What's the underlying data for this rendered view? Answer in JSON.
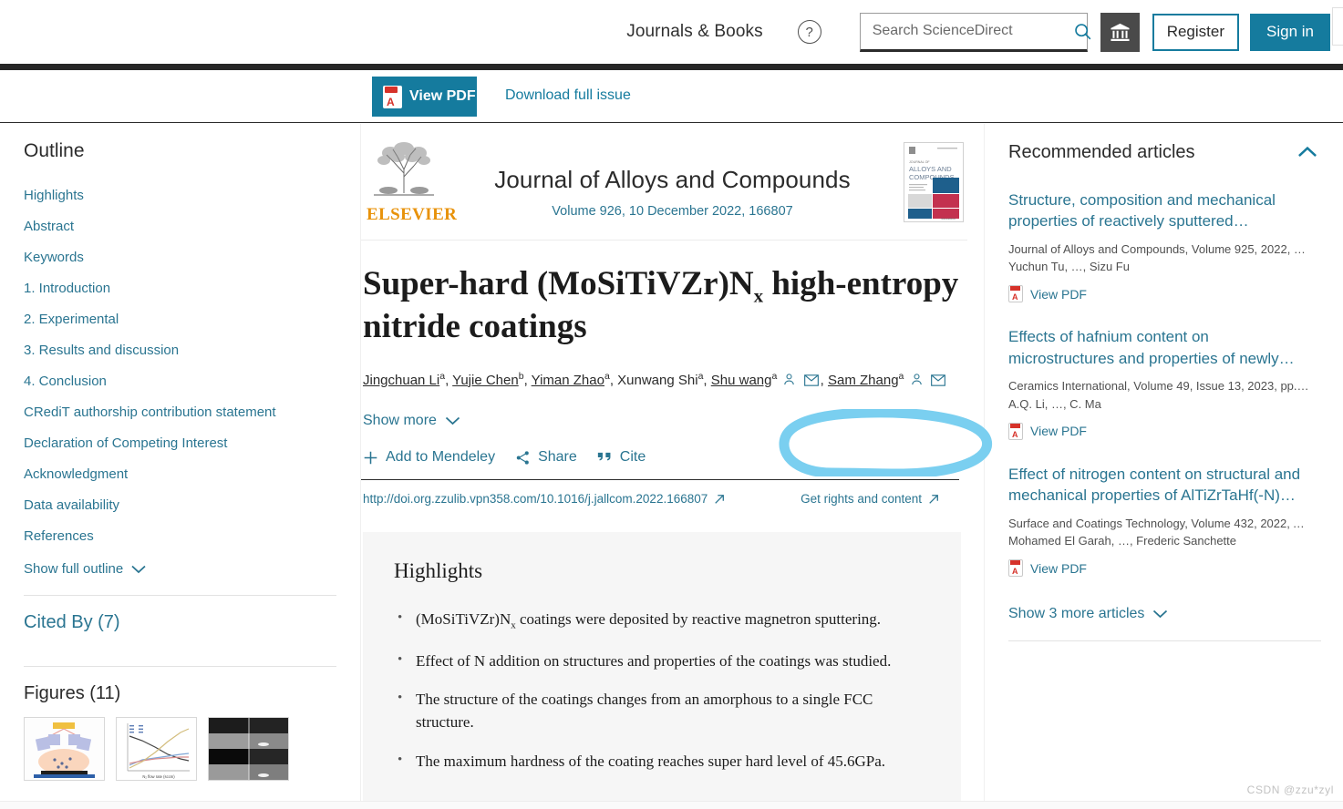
{
  "header": {
    "journals_books": "Journals & Books",
    "help_icon": "question-mark-icon",
    "search_placeholder": "Search ScienceDirect",
    "search_value": "",
    "search_icon": "search-icon",
    "institution_icon": "institution-bank-icon",
    "register_label": "Register",
    "signin_label": "Sign in"
  },
  "pdfbar": {
    "view_pdf_label": "View PDF",
    "download_issue_label": "Download full issue"
  },
  "outline": {
    "title": "Outline",
    "items": [
      {
        "label": "Highlights"
      },
      {
        "label": "Abstract"
      },
      {
        "label": "Keywords"
      },
      {
        "label": "1. Introduction"
      },
      {
        "label": "2. Experimental"
      },
      {
        "label": "3. Results and discussion"
      },
      {
        "label": "4. Conclusion"
      },
      {
        "label": "CRediT authorship contribution statement"
      },
      {
        "label": "Declaration of Competing Interest"
      },
      {
        "label": "Acknowledgment"
      },
      {
        "label": "Data availability"
      },
      {
        "label": "References"
      }
    ],
    "show_full_label": "Show full outline",
    "cited_by_label": "Cited By (7)",
    "figures_label": "Figures (11)"
  },
  "journal": {
    "publisher": "ELSEVIER",
    "name": "Journal of Alloys and Compounds",
    "volume_line": "Volume 926, 10 December 2022, 166807",
    "cover_title_line1": "JOURNAL OF",
    "cover_title_line2": "ALLOYS AND",
    "cover_title_line3": "COMPOUNDS"
  },
  "article": {
    "title_pre": "Super-hard (MoSiTiVZr)N",
    "title_sub": "x",
    "title_post": " high-entropy nitride coatings",
    "authors_html": "Jingchuan Li, Yujie Chen, Yiman Zhao, Xunwang Shi, Shu wang, Sam Zhang",
    "authors": [
      {
        "name": "Jingchuan Li",
        "sup": "a",
        "link": true,
        "icons": []
      },
      {
        "name": "Yujie Chen",
        "sup": "b",
        "link": true,
        "icons": []
      },
      {
        "name": "Yiman Zhao",
        "sup": "a",
        "link": true,
        "icons": []
      },
      {
        "name": "Xunwang Shi",
        "sup": "a",
        "link": false,
        "icons": []
      },
      {
        "name": "Shu wang",
        "sup": "a",
        "link": true,
        "icons": [
          "person-icon",
          "envelope-icon"
        ]
      },
      {
        "name": "Sam Zhang",
        "sup": "a",
        "link": true,
        "icons": [
          "person-icon",
          "envelope-icon"
        ]
      }
    ],
    "show_more_label": "Show more",
    "actions": [
      {
        "label": "Add to Mendeley",
        "icon": "plus-icon"
      },
      {
        "label": "Share",
        "icon": "share-nodes-icon"
      },
      {
        "label": "Cite",
        "icon": "quote-icon"
      }
    ],
    "doi_url": "http://doi.org.zzulib.vpn358.com/10.1016/j.jallcom.2022.166807",
    "rights_label": "Get rights and content"
  },
  "highlights": {
    "title": "Highlights",
    "items": [
      {
        "pre": "(MoSiTiVZr)N",
        "sub": "x",
        "post": " coatings were deposited by reactive magnetron sputtering."
      },
      {
        "pre": "Effect of N addition on structures and properties of the coatings was studied.",
        "sub": "",
        "post": ""
      },
      {
        "pre": "The structure of the coatings changes from an amorphous to a single FCC structure.",
        "sub": "",
        "post": ""
      },
      {
        "pre": "The maximum hardness of the coating reaches super hard level of 45.6GPa.",
        "sub": "",
        "post": ""
      }
    ]
  },
  "recommended": {
    "title": "Recommended articles",
    "collapse_icon": "chevron-up-icon",
    "articles": [
      {
        "title": "Structure, composition and mechanical properties of reactively sputtered…",
        "meta": "Journal of Alloys and Compounds, Volume 925, 2022, …",
        "authors": "Yuchun Tu, …, Sizu Fu",
        "pdf_label": "View PDF"
      },
      {
        "title": "Effects of hafnium content on microstructures and properties of newly…",
        "meta": "Ceramics International, Volume 49, Issue 13, 2023, pp.…",
        "authors": "A.Q. Li, …, C. Ma",
        "pdf_label": "View PDF"
      },
      {
        "title": "Effect of nitrogen content on structural and mechanical properties of AlTiZrTaHf(-N)…",
        "meta": "Surface and Coatings Technology, Volume 432, 2022, A…",
        "authors": "Mohamed El Garah, …, Frederic Sanchette",
        "pdf_label": "View PDF"
      }
    ],
    "show_more_label": "Show 3 more articles"
  },
  "annotation": {
    "shape": "hand-drawn-ellipse",
    "color": "#7ACFF0",
    "target": "Get rights and content"
  },
  "watermark": {
    "text": "CSDN @zzu*zyl"
  },
  "colors": {
    "brand_teal": "#157b9e",
    "link_teal": "#2a7591",
    "dark_bar": "#262626",
    "highlight_bg": "#f6f6f6",
    "elsevier_orange": "#e8920a",
    "annotation_blue": "#7ACFF0"
  }
}
